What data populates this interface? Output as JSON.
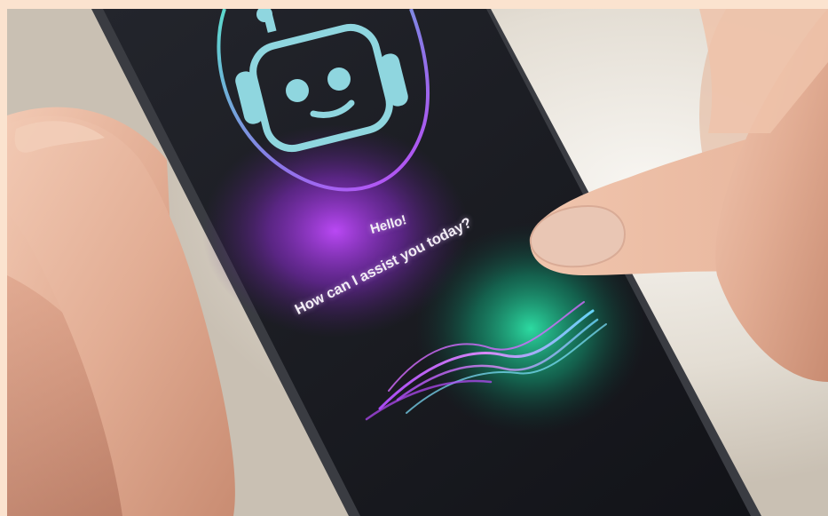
{
  "assistant_screen": {
    "greeting_line1": "Hello!",
    "greeting_line2": "How can I assist you today?"
  },
  "colors": {
    "frame_background": "#fbe3cf",
    "phone_screen": "#1a1c22",
    "robot_icon": "#8fd6df",
    "ring_purple": "#b84cff",
    "ring_teal": "#4fe0d0",
    "wave_glow_green": "#1fd39a",
    "skin_tone": "#e9b9a1",
    "nail_color": "#e9c6b4"
  },
  "icons": {
    "assistant_avatar": "robot-icon",
    "voice_wave": "waveform-icon"
  }
}
